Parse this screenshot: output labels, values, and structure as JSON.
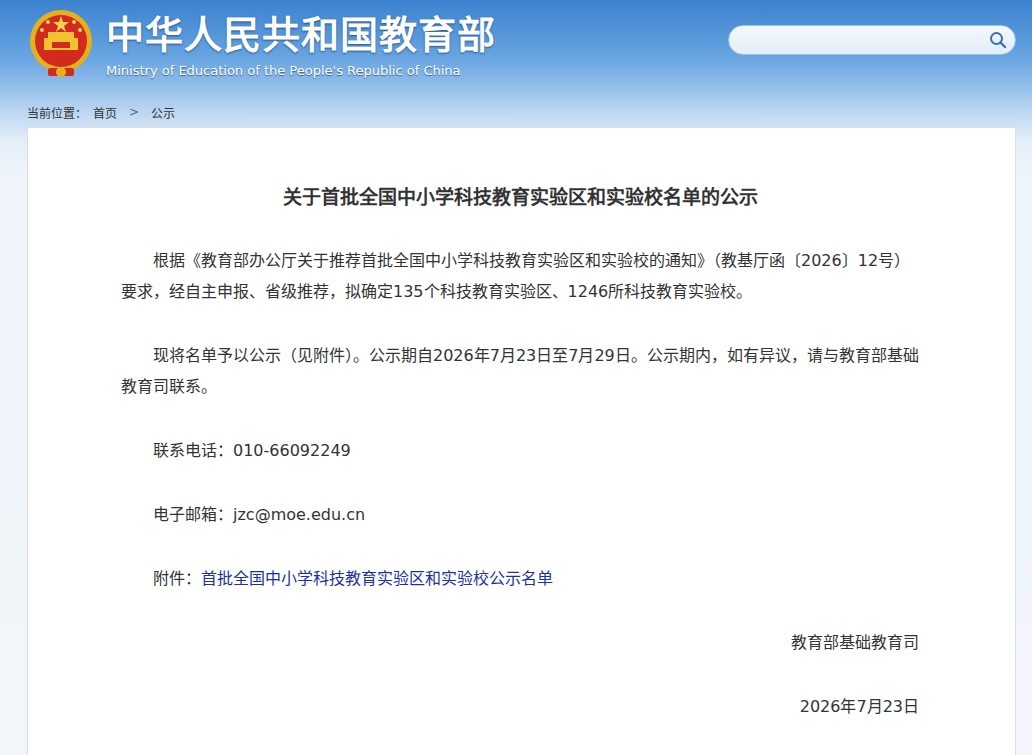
{
  "header": {
    "title": "中华人民共和国教育部",
    "subtitle": "Ministry of Education of the People's Republic of China"
  },
  "search": {
    "placeholder": ""
  },
  "breadcrumb": {
    "label": "当前位置：",
    "items": [
      "首页",
      "公示"
    ],
    "separator": ">"
  },
  "article": {
    "title": "关于首批全国中小学科技教育实验区和实验校名单的公示",
    "paragraphs": [
      "根据《教育部办公厅关于推荐首批全国中小学科技教育实验区和实验校的通知》（教基厅函〔2026〕12号）要求，经自主申报、省级推荐，拟确定135个科技教育实验区、1246所科技教育实验校。",
      "现将名单予以公示（见附件）。公示期自2026年7月23日至7月29日。公示期内，如有异议，请与教育部基础教育司联系。",
      "联系电话：010-66092249",
      "电子邮箱：jzc@moe.edu.cn"
    ],
    "attachment": {
      "label": "附件：",
      "link": "首批全国中小学科技教育实验区和实验校公示名单"
    },
    "signature": "教育部基础教育司",
    "date": "2026年7月23日"
  }
}
